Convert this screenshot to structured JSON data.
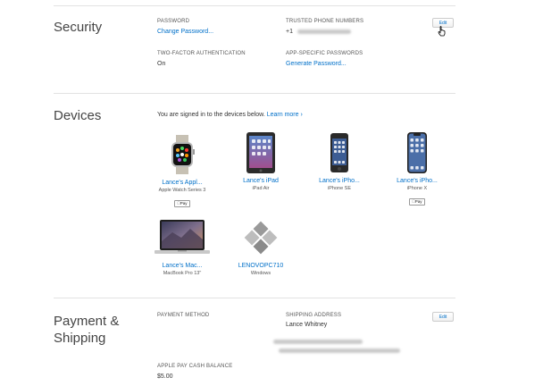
{
  "security": {
    "title": "Security",
    "password_label": "PASSWORD",
    "password_link": "Change Password...",
    "trusted_label": "TRUSTED PHONE NUMBERS",
    "trusted_prefix": "+1",
    "edit_label": "Edit",
    "two_factor_label": "TWO-FACTOR AUTHENTICATION",
    "two_factor_value": "On",
    "app_passwords_label": "APP-SPECIFIC PASSWORDS",
    "app_passwords_link": "Generate Password..."
  },
  "devices": {
    "title": "Devices",
    "intro": "You are signed in to the devices below.",
    "learn_more": "Learn more ›",
    "items": [
      {
        "name": "Lance's Appl...",
        "model": "Apple Watch Series 3",
        "badge": "Pay",
        "icon": "apple-watch-icon"
      },
      {
        "name": "Lance's iPad",
        "model": "iPad Air",
        "badge": "",
        "icon": "ipad-icon"
      },
      {
        "name": "Lance's iPho...",
        "model": "iPhone SE",
        "badge": "",
        "icon": "iphone-se-icon"
      },
      {
        "name": "Lance's iPho...",
        "model": "iPhone X",
        "badge": "Pay",
        "icon": "iphone-x-icon"
      },
      {
        "name": "Lance's Mac...",
        "model": "MacBook Pro 13\"",
        "badge": "",
        "icon": "macbook-icon"
      },
      {
        "name": "LENOVOPC710",
        "model": "Windows",
        "badge": "",
        "icon": "windows-icon"
      }
    ]
  },
  "payment": {
    "title_line1": "Payment &",
    "title_line2": "Shipping",
    "method_label": "PAYMENT METHOD",
    "shipping_label": "SHIPPING ADDRESS",
    "shipping_name": "Lance Whitney",
    "edit_label": "Edit",
    "cash_label": "APPLE PAY CASH BALANCE",
    "cash_value": "$5.00"
  },
  "colors": {
    "link": "#0070c9",
    "separator": "#e2e2e2",
    "text": "#333333"
  }
}
